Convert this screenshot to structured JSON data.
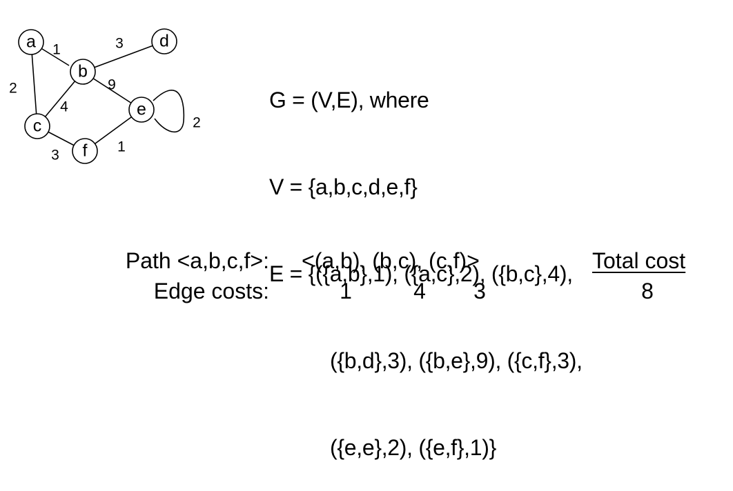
{
  "graph": {
    "nodes": [
      "a",
      "b",
      "c",
      "d",
      "e",
      "f"
    ],
    "edges": [
      {
        "from": "a",
        "to": "b",
        "weight": "1"
      },
      {
        "from": "a",
        "to": "c",
        "weight": "2"
      },
      {
        "from": "b",
        "to": "c",
        "weight": "4"
      },
      {
        "from": "b",
        "to": "d",
        "weight": "3"
      },
      {
        "from": "b",
        "to": "e",
        "weight": "9"
      },
      {
        "from": "c",
        "to": "f",
        "weight": "3"
      },
      {
        "from": "e",
        "to": "e",
        "weight": "2"
      },
      {
        "from": "e",
        "to": "f",
        "weight": "1"
      }
    ]
  },
  "definition": {
    "line1": "G = (V,E), where",
    "line2": "V = {a,b,c,d,e,f}",
    "line3": "E = {({a,b},1), ({a,c},2), ({b,c},4),",
    "line4": "({b,d},3), ({b,e},9), ({c,f},3),",
    "line5": "({e,e},2), ({e,f},1)}"
  },
  "path": {
    "label": "Path <a,b,c,f>:",
    "edges": "<(a,b), (b,c), (c,f)>",
    "costs_label": "Edge costs:",
    "costs": [
      "1",
      "4",
      "3"
    ],
    "total_label": "Total cost",
    "total_value": "8"
  }
}
